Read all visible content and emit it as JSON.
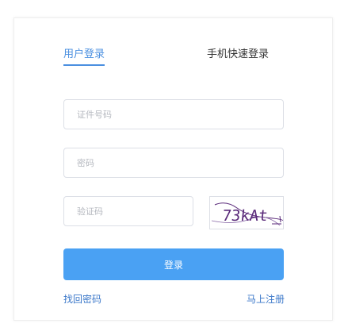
{
  "tabs": {
    "user_login": "用户登录",
    "phone_login": "手机快速登录"
  },
  "fields": {
    "id_placeholder": "证件号码",
    "password_placeholder": "密码",
    "code_placeholder": "验证码"
  },
  "captcha": {
    "text": "73kAt"
  },
  "buttons": {
    "login": "登录"
  },
  "links": {
    "forgot_password": "找回密码",
    "register": "马上注册"
  },
  "colors": {
    "accent": "#4a8fe0",
    "button": "#4aa1f3",
    "link": "#3a77c9",
    "captcha_text": "#5a2a7a"
  }
}
